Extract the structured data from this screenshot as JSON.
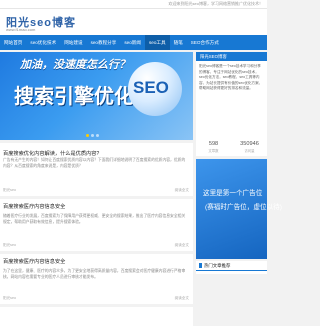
{
  "topbar": {
    "welcome": "欢迎来到阳光seo博客，学习网络营销推广优化技术！"
  },
  "site": {
    "title": "阳光seo博客",
    "url": "www.f1mao.com"
  },
  "nav": [
    {
      "label": "网站首页"
    },
    {
      "label": "seo优化技术"
    },
    {
      "label": "网站建设"
    },
    {
      "label": "seo教程分享"
    },
    {
      "label": "seo新闻"
    },
    {
      "label": "seo工具",
      "active": true
    },
    {
      "label": "随笔"
    },
    {
      "label": "SEO合作方式"
    }
  ],
  "banner": {
    "slogan": "加油，没速度怎么行？",
    "headline": "搜索引擎优化",
    "badge": "SEO"
  },
  "posts": [
    {
      "title": "百度搜索优化内容解读，什么是优质内容?",
      "excerpt": "广告有无产生的内容！如何让百度搜索优质内容以内容？下面我们详细地说明了百度搜索的优质内容，优质的内容？从百度搜索的角度来说是，内容是优质？",
      "meta": "阳光seo",
      "more": "阅读全文"
    },
    {
      "title": "百度搜索医疗内容信息安全",
      "excerpt": "随着医疗行业的发展，百度搜索为了保障用户获得更权威、更安全的搜索结果，推出了医疗内容信息安全相关规定，帮助用户获取有效信息，提升搜索体验。",
      "meta": "阳光seo",
      "more": "阅读全文"
    },
    {
      "title": "百度搜索医疗内容信息安全",
      "excerpt": "为了在这里，健康、医疗的内容众多，为了更安全地获得高质量内容，百度搜索会对医疗健康内容进行严格审核，网站内容也需要专业的医疗人员进行审核才能发布。",
      "meta": "阳光seo",
      "more": "阅读全文"
    },
    {
      "title": "",
      "excerpt": "",
      "meta": "",
      "more": ""
    }
  ],
  "about": {
    "heading": "阳光SEO博客",
    "intro": "阳光seo博客是一个seo技术学习和分享的博客，专注于网站优化的seo技术，seo优化方法，seo教程，seo工具等内容，为站长提供有价值的seo优化方案，帮助网站获得更好的排名和流量。",
    "stats": [
      {
        "value": "598",
        "label": "文章数"
      },
      {
        "value": "350946",
        "label": "访问量"
      }
    ]
  },
  "ad": {
    "line1": "这里是第一个广告位",
    "line2": "(赛福时广告位，虚位以待)",
    "line3": ""
  },
  "hot": {
    "heading": "热门文章推荐"
  },
  "colors": {
    "nav": "#1778d3",
    "brand": "#2f63a8",
    "nav_active": "#0e5ea8"
  }
}
